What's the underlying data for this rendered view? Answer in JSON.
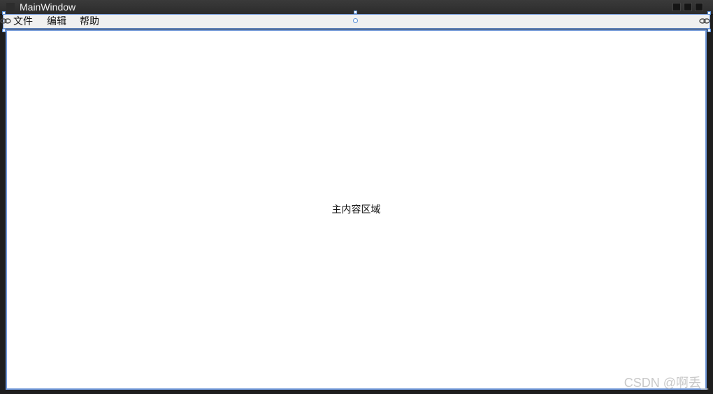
{
  "window": {
    "title": "MainWindow"
  },
  "menubar": {
    "items": [
      {
        "label": "文件"
      },
      {
        "label": "编辑"
      },
      {
        "label": "帮助"
      }
    ]
  },
  "content": {
    "label": "主内容区域"
  },
  "watermark": "CSDN @啊丢_",
  "colors": {
    "titlebar": "#2f2f2f",
    "selection": "#6f97d8",
    "menubar": "#f0f0f0",
    "content": "#ffffff"
  }
}
